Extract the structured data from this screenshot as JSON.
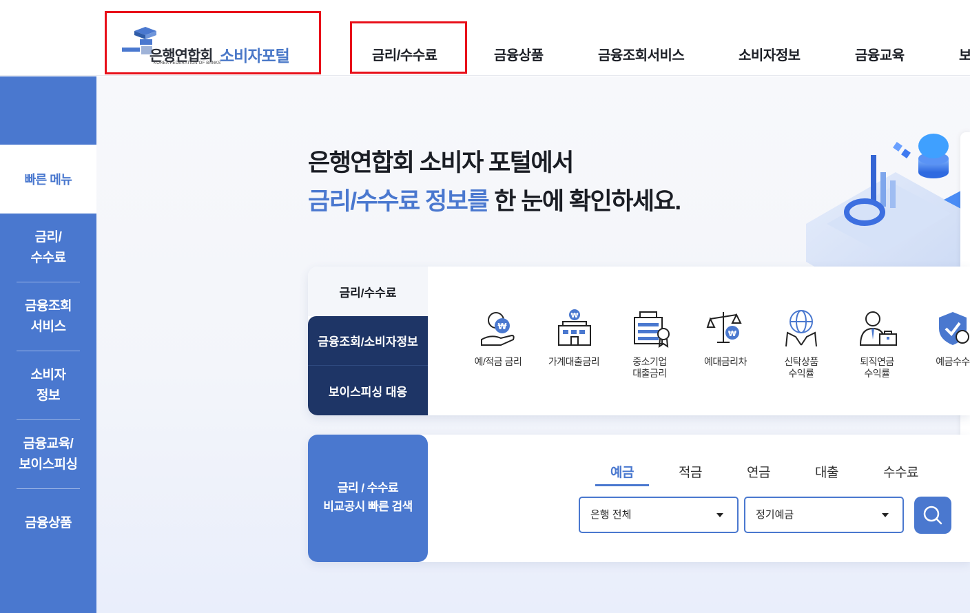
{
  "header": {
    "logo_ko": "은행연합회",
    "logo_en": "KOREA FEDERATION OF BANKS",
    "logo_portal": "소비자포털",
    "gnb": [
      "금리/수수료",
      "금융상품",
      "금융조회서비스",
      "소비자정보",
      "금융교육",
      "보"
    ]
  },
  "sidebar": {
    "quick_label": "빠른 메뉴",
    "items": [
      {
        "line1": "금리/",
        "line2": "수수료"
      },
      {
        "line1": "금융조회",
        "line2": "서비스"
      },
      {
        "line1": "소비자",
        "line2": "정보"
      },
      {
        "line1": "금융교육/",
        "line2": "보이스피싱"
      },
      {
        "line1": "금융상품",
        "line2": ""
      }
    ]
  },
  "hero": {
    "line1": "은행연합회 소비자 포털에서",
    "line2_accent": "금리/수수료 정보를",
    "line2_rest": " 한 눈에 확인하세요."
  },
  "quick_tabs": {
    "tab1": "금리/수수료",
    "tab2": "금융조회/소비자정보",
    "tab3": "보이스피싱 대응"
  },
  "quick_icons": [
    {
      "icon": "savings-rate-icon",
      "label": "예/적금 금리"
    },
    {
      "icon": "household-loan-icon",
      "label": "가계대출금리"
    },
    {
      "icon": "sme-loan-icon",
      "label": "중소기업\n대출금리"
    },
    {
      "icon": "deposit-loan-spread-icon",
      "label": "예대금리차"
    },
    {
      "icon": "trust-product-icon",
      "label": "신탁상품\n수익률"
    },
    {
      "icon": "pension-icon",
      "label": "퇴직연금\n수익률"
    },
    {
      "icon": "deposit-fee-icon",
      "label": "예금수수"
    }
  ],
  "rate_search": {
    "title_line1": "금리 / 수수료",
    "title_line2": "비교공시 빠른 검색",
    "tabs": [
      "예금",
      "적금",
      "연금",
      "대출",
      "수수료"
    ],
    "active_tab": "예금",
    "bank_select": "은행 전체",
    "product_select": "정기예금"
  },
  "colors": {
    "primary": "#4a78cf",
    "navy": "#1e3566",
    "highlight_red": "#e8101a"
  }
}
